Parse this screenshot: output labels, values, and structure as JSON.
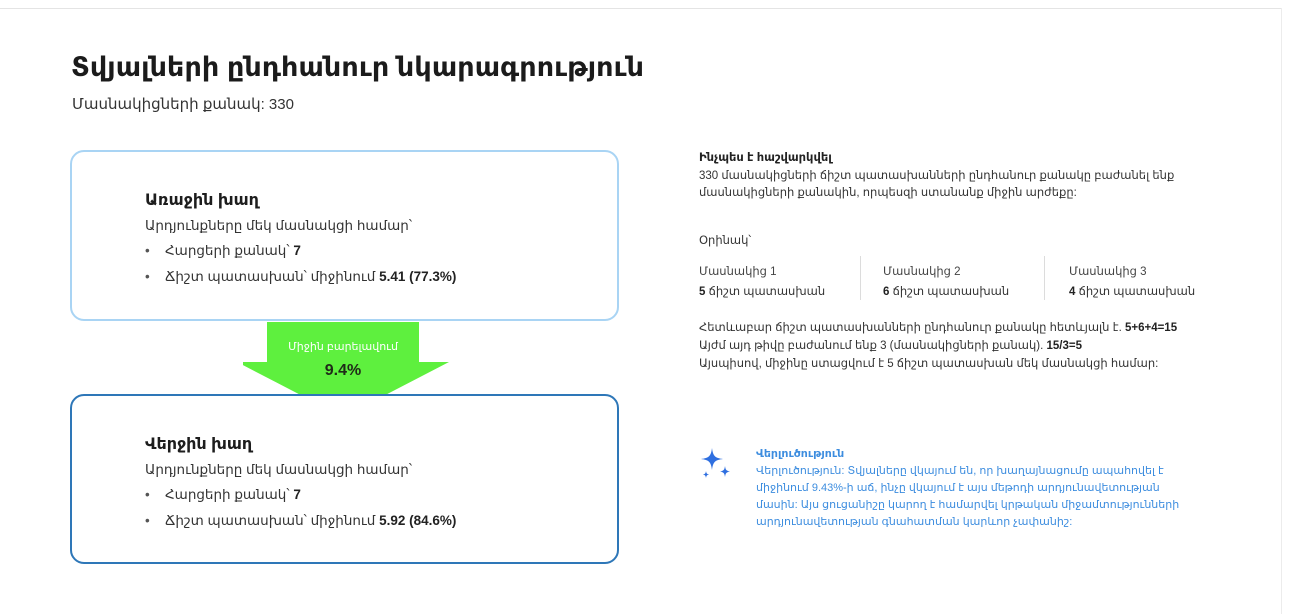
{
  "page": {
    "title": "Տվյալների ընդհանուր նկարագրություն",
    "subtitle": "Մասնակիցների քանակ: 330"
  },
  "first_game": {
    "title": "Առաջին խաղ",
    "desc": "Արդյունքները մեկ մասնակցի համար՝",
    "questions_label": "Հարցերի քանակ՝",
    "questions_value": "7",
    "correct_label": "Ճիշտ պատասխան՝ միջինում",
    "correct_value": "5.41 (77.3%)"
  },
  "improvement": {
    "label": "Միջին բարելավում",
    "value": "9.4%",
    "color": "#5ef03e"
  },
  "last_game": {
    "title": "Վերջին խաղ",
    "desc": "Արդյունքները մեկ մասնակցի համար՝",
    "questions_label": "Հարցերի քանակ՝",
    "questions_value": "7",
    "correct_label": "Ճիշտ պատասխան՝ միջինում",
    "correct_value": "5.92 (84.6%)"
  },
  "calculation": {
    "title": "Ինչպես է հաշվարկվել",
    "text": "330 մասնակիցների ճիշտ պատասխանների ընդհանուր քանակը բաժանել ենք մասնակիցների քանակին, որպեսզի ստանանք միջին արժեքը:",
    "example_label": "Օրինակ՝",
    "participants": [
      {
        "name": "Մասնակից 1",
        "count": "5",
        "suffix": "ճիշտ պատասխան"
      },
      {
        "name": "Մասնակից 2",
        "count": "6",
        "suffix": "ճիշտ պատասխան"
      },
      {
        "name": "Մասնակից 3",
        "count": "4",
        "suffix": "ճիշտ պատասխան"
      }
    ],
    "line1_text": "Հետևաբար ճիշտ պատասխանների ընդհանուր քանակը հետևյալն է.",
    "line1_bold": "5+6+4=15",
    "line2_text": "Այժմ այդ թիվը բաժանում ենք 3 (մասնակիցների քանակ).",
    "line2_bold": "15/3=5",
    "line3_text": "Այսպիսով, միջինը ստացվում է 5 ճիշտ պատասխան մեկ մասնակցի համար:"
  },
  "analysis": {
    "icon": "sparkle-icon",
    "title": "Վերլուծություն",
    "text": "Վերլուծություն: Տվյալները վկայում են, որ խաղայնացումը ապահովել է միջինում 9.43%-ի աճ, ինչը վկայում է այս մեթոդի արդյունավետության մասին: Այս ցուցանիշը կարող է համարվել կրթական միջամտությունների արդյունավետության գնահատման կարևոր չափանիշ:",
    "color": "#3d8ddf"
  }
}
